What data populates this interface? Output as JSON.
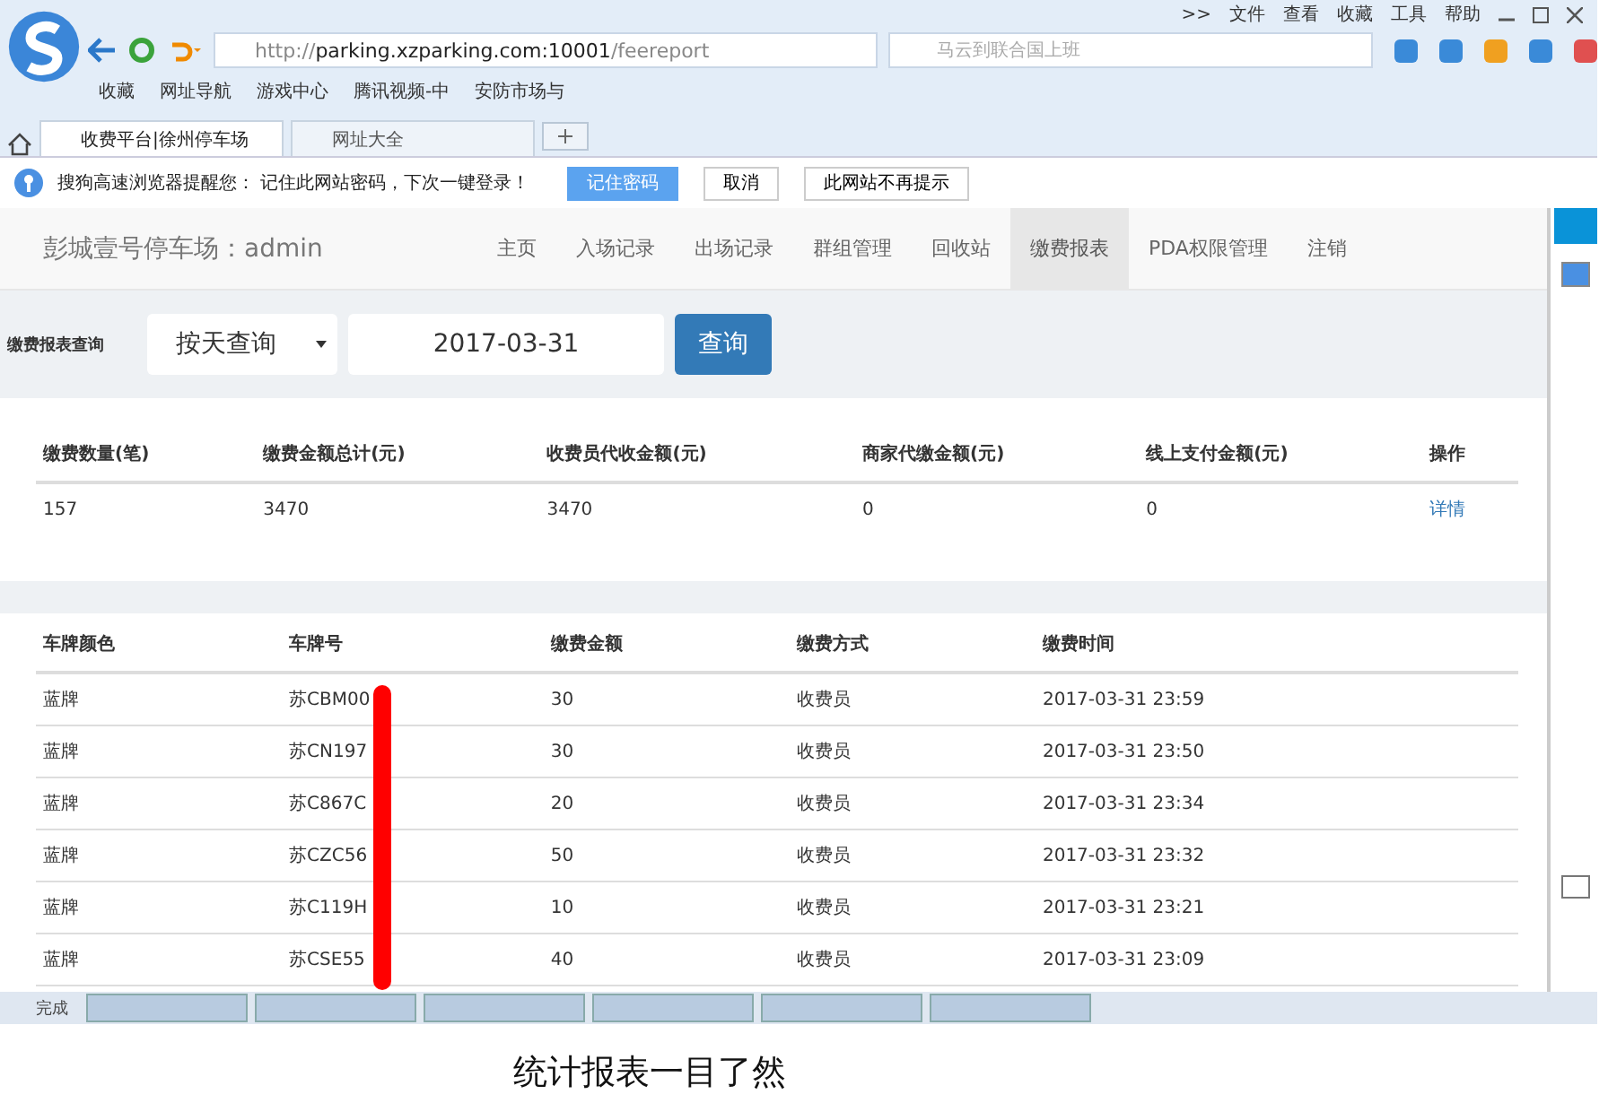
{
  "browser": {
    "menu": [
      ">>",
      "文件",
      "查看",
      "收藏",
      "工具",
      "帮助"
    ],
    "url_prefix": "http://",
    "url_host": "parking.xzparking.com:10001",
    "url_path": "/feereport",
    "search_placeholder": "马云到联合国上班",
    "bookmarks": [
      "收藏",
      "网址导航",
      "游戏中心",
      "腾讯视频-中",
      "安防市场与"
    ],
    "tabs": [
      {
        "label": "收费平台|徐州停车场",
        "selected": true
      },
      {
        "label": "网址大全",
        "selected": false
      }
    ],
    "notice": {
      "text": "搜狗高速浏览器提醒您： 记住此网站密码，下次一键登录！",
      "buttons": [
        "记住密码",
        "取消",
        "此网站不再提示"
      ]
    },
    "status": "完成"
  },
  "header": {
    "brand": "彭城壹号停车场：admin",
    "nav": [
      {
        "label": "主页",
        "selected": false
      },
      {
        "label": "入场记录",
        "selected": false
      },
      {
        "label": "出场记录",
        "selected": false
      },
      {
        "label": "群组管理",
        "selected": false
      },
      {
        "label": "回收站",
        "selected": false
      },
      {
        "label": "缴费报表",
        "selected": true
      },
      {
        "label": "PDA权限管理",
        "selected": false
      },
      {
        "label": "注销",
        "selected": false
      }
    ]
  },
  "query": {
    "label": "缴费报表查询",
    "mode": "按天查询",
    "date": "2017-03-31",
    "button": "查询"
  },
  "summary": {
    "columns": [
      "缴费数量(笔)",
      "缴费金额总计(元)",
      "收费员代收金额(元)",
      "商家代缴金额(元)",
      "线上支付金额(元)",
      "操作"
    ],
    "row": [
      "157",
      "3470",
      "3470",
      "0",
      "0"
    ],
    "link": "详情"
  },
  "records": {
    "columns": [
      "车牌颜色",
      "车牌号",
      "缴费金额",
      "缴费方式",
      "缴费时间"
    ],
    "rows": [
      [
        "蓝牌",
        "苏CBM00",
        "30",
        "收费员",
        "2017-03-31 23:59"
      ],
      [
        "蓝牌",
        "苏CN197",
        "30",
        "收费员",
        "2017-03-31 23:50"
      ],
      [
        "蓝牌",
        "苏C867C",
        "20",
        "收费员",
        "2017-03-31 23:34"
      ],
      [
        "蓝牌",
        "苏CZC56",
        "50",
        "收费员",
        "2017-03-31 23:32"
      ],
      [
        "蓝牌",
        "苏C119H",
        "10",
        "收费员",
        "2017-03-31 23:21"
      ],
      [
        "蓝牌",
        "苏CSE55",
        "40",
        "收费员",
        "2017-03-31 23:09"
      ]
    ]
  },
  "caption": "统计报表一目了然"
}
